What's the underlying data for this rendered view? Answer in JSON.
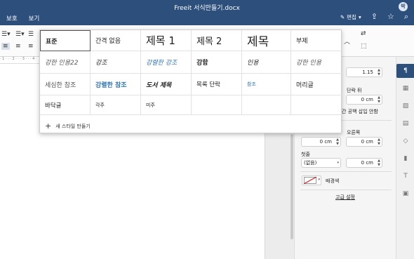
{
  "window": {
    "title": "Freeit 서식만들기.docx",
    "avatar": "박"
  },
  "menu": [
    "보호",
    "보기"
  ],
  "toolbar": {
    "edit_label": "편집",
    "edit_icon": "pencil-icon",
    "share_icon": "share-icon",
    "star_icon": "star-icon",
    "search_icon": "search-icon"
  },
  "ruler_text": "· 1 · · · 2 · · · 3 · · · 4 ·",
  "styles": {
    "items": [
      [
        {
          "label": "표준"
        },
        {
          "label": "간격 없음"
        },
        {
          "label": "제목 1"
        },
        {
          "label": "제목 2"
        },
        {
          "label": "제목"
        },
        {
          "label": "부제"
        }
      ],
      [
        {
          "label": "강한 인용22"
        },
        {
          "label": "강조"
        },
        {
          "label": "강렬한 강조"
        },
        {
          "label": "강함"
        },
        {
          "label": "인용"
        },
        {
          "label": "강한 인용"
        }
      ],
      [
        {
          "label": "세심한 참조"
        },
        {
          "label": "강렬한 참조"
        },
        {
          "label": "도서 제목"
        },
        {
          "label": "목록 단락"
        },
        {
          "label": "참조"
        },
        {
          "label": "머리글"
        }
      ],
      [
        {
          "label": "바닥글"
        },
        {
          "label": "각주"
        },
        {
          "label": "미주"
        },
        {
          "label": ""
        },
        {
          "label": ""
        },
        {
          "label": ""
        }
      ]
    ],
    "new_style_label": "새 스타일 만들기",
    "accent_color": "#2e74b5"
  },
  "panel": {
    "line_spacing": "1.15",
    "paragraph_after_label": "단락 뒤",
    "paragraph_after_value": "0 cm",
    "no_space_label": "간 공백 삽입 안함",
    "indent_left_value": "0 cm",
    "indent_right_label": "오른쪽",
    "indent_right_value": "0 cm",
    "first_line_label": "첫줄",
    "first_line_select": "(없음)",
    "first_line_value": "0 cm",
    "background_label": "배경색",
    "advanced_label": "고급 설정"
  },
  "colors": {
    "titlebar": "#2d4f7c",
    "active_tab": "#2d4f7c"
  }
}
